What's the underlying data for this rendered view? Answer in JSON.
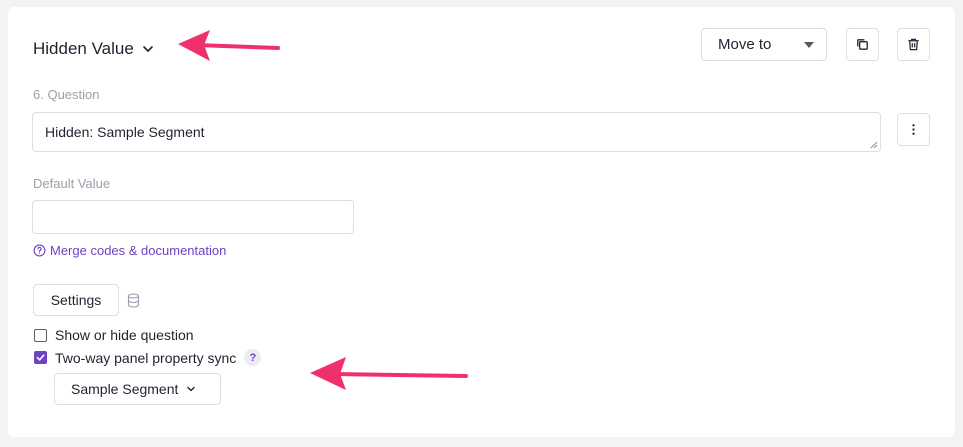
{
  "question_type": {
    "label": "Hidden Value",
    "icon": "chevron-down-icon"
  },
  "toolbar": {
    "move_to": "Move to",
    "copy_icon": "copy-icon",
    "delete_icon": "trash-icon",
    "more_icon": "more-vertical-icon"
  },
  "question": {
    "label": "6. Question",
    "value": "Hidden: Sample Segment"
  },
  "default_value": {
    "label": "Default Value",
    "value": ""
  },
  "merge_link": {
    "label": "Merge codes & documentation",
    "icon": "help-circle-icon"
  },
  "settings_button": "Settings",
  "database_icon": "database-icon",
  "checkboxes": [
    {
      "label": "Show or hide question",
      "checked": false
    },
    {
      "label": "Two-way panel property sync",
      "checked": true,
      "help": "?"
    }
  ],
  "segment_select": {
    "value": "Sample Segment"
  },
  "colors": {
    "accent": "#6f42c1",
    "annotation_arrow": "#f0306a"
  }
}
